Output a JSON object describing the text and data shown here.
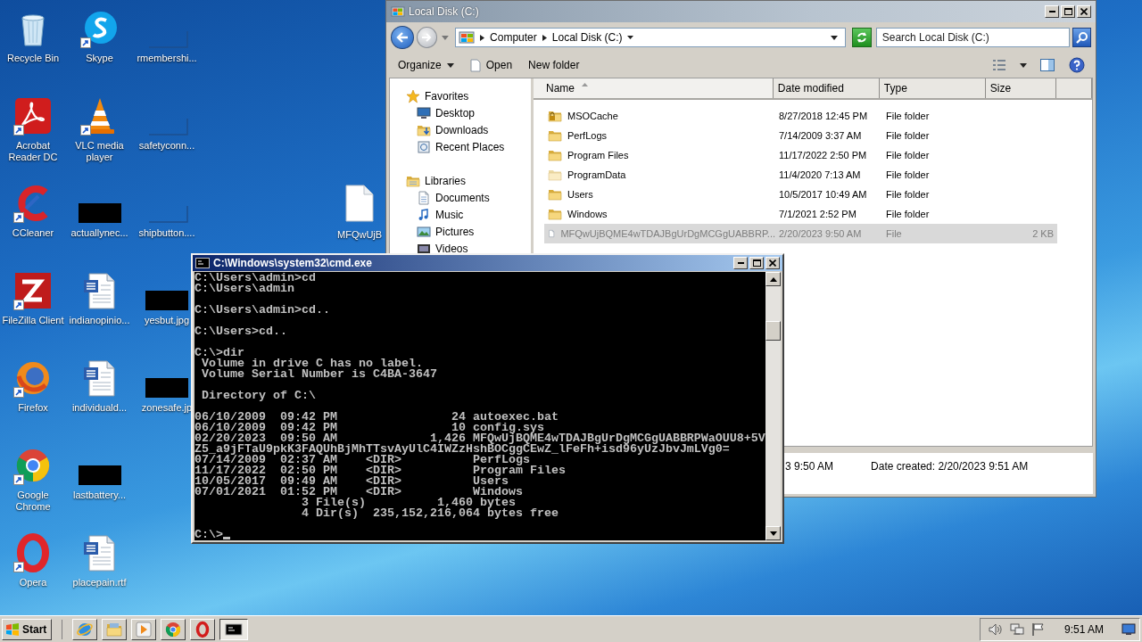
{
  "desktop": {
    "icons": [
      {
        "label": "Recycle Bin",
        "kind": "recycle-bin",
        "shortcut": false
      },
      {
        "label": "Acrobat Reader DC",
        "kind": "acrobat",
        "shortcut": true
      },
      {
        "label": "CCleaner",
        "kind": "ccleaner",
        "shortcut": true
      },
      {
        "label": "FileZilla Client",
        "kind": "filezilla",
        "shortcut": true
      },
      {
        "label": "Firefox",
        "kind": "firefox",
        "shortcut": true
      },
      {
        "label": "Google Chrome",
        "kind": "chrome",
        "shortcut": true
      },
      {
        "label": "Opera",
        "kind": "opera",
        "shortcut": true
      },
      {
        "label": "Skype",
        "kind": "skype",
        "shortcut": true
      },
      {
        "label": "VLC media player",
        "kind": "vlc",
        "shortcut": true
      },
      {
        "label": "actuallynec...",
        "kind": "thumbnail",
        "shortcut": false
      },
      {
        "label": "indianopinio...",
        "kind": "word",
        "shortcut": false
      },
      {
        "label": "individuald...",
        "kind": "word",
        "shortcut": false
      },
      {
        "label": "lastbattery...",
        "kind": "thumbnail",
        "shortcut": false
      },
      {
        "label": "placepain.rtf",
        "kind": "word",
        "shortcut": false
      },
      {
        "label": "rmembershi...",
        "kind": "blank",
        "shortcut": false
      },
      {
        "label": "safetyconn...",
        "kind": "blank",
        "shortcut": false
      },
      {
        "label": "shipbutton....",
        "kind": "blank",
        "shortcut": false
      },
      {
        "label": "yesbut.jpg",
        "kind": "thumbnail",
        "shortcut": false
      },
      {
        "label": "zonesafe.jp",
        "kind": "thumbnail",
        "shortcut": false
      }
    ],
    "loose_icon": {
      "label": "MFQwUjB",
      "kind": "file"
    }
  },
  "explorer": {
    "title": "Local Disk (C:)",
    "breadcrumbs": [
      "Computer",
      "Local Disk (C:)"
    ],
    "search_placeholder": "Search Local Disk (C:)",
    "commands": [
      {
        "label": "Organize",
        "kind": "menu"
      },
      {
        "label": "Open",
        "kind": "open"
      },
      {
        "label": "New folder",
        "kind": "plain"
      }
    ],
    "navigation": [
      {
        "label": "Favorites",
        "kind": "star",
        "children": [
          {
            "label": "Desktop",
            "kind": "desktop"
          },
          {
            "label": "Downloads",
            "kind": "downloads"
          },
          {
            "label": "Recent Places",
            "kind": "recent"
          }
        ]
      },
      {
        "label": "Libraries",
        "kind": "library",
        "children": [
          {
            "label": "Documents",
            "kind": "documents"
          },
          {
            "label": "Music",
            "kind": "music"
          },
          {
            "label": "Pictures",
            "kind": "pictures"
          },
          {
            "label": "Videos",
            "kind": "videos"
          }
        ]
      }
    ],
    "columns": [
      {
        "label": "Name",
        "sorted": true
      },
      {
        "label": "Date modified",
        "sorted": false
      },
      {
        "label": "Type",
        "sorted": false
      },
      {
        "label": "Size",
        "sorted": false
      }
    ],
    "rows": [
      {
        "name": "MSOCache",
        "date_modified": "8/27/2018 12:45 PM",
        "type": "File folder",
        "kind": "folder-locked",
        "selected": false
      },
      {
        "name": "PerfLogs",
        "date_modified": "7/14/2009 3:37 AM",
        "type": "File folder",
        "kind": "folder",
        "selected": false
      },
      {
        "name": "Program Files",
        "date_modified": "11/17/2022 2:50 PM",
        "type": "File folder",
        "kind": "folder",
        "selected": false
      },
      {
        "name": "ProgramData",
        "date_modified": "11/4/2020 7:13 AM",
        "type": "File folder",
        "kind": "folder-faded",
        "selected": false
      },
      {
        "name": "Users",
        "date_modified": "10/5/2017 10:49 AM",
        "type": "File folder",
        "kind": "folder",
        "selected": false
      },
      {
        "name": "Windows",
        "date_modified": "7/1/2021 2:52 PM",
        "type": "File folder",
        "kind": "folder",
        "selected": false
      },
      {
        "name": "MFQwUjBQME4wTDAJBgUrDgMCGgUABBRP...",
        "date_modified": "2/20/2023 9:50 AM",
        "type": "File",
        "size": "2 KB",
        "kind": "file",
        "selected": true
      }
    ],
    "details": [
      "3 9:50 AM",
      "Date created: 2/20/2023 9:51 AM"
    ]
  },
  "console": {
    "title": "C:\\Windows\\system32\\cmd.exe",
    "cursor": true,
    "blocks": [
      [
        "C:\\Users\\admin>cd",
        "C:\\Users\\admin"
      ],
      [
        "C:\\Users\\admin>cd.."
      ],
      [
        "C:\\Users>cd.."
      ],
      [
        "C:\\>dir",
        " Volume in drive C has no label.",
        " Volume Serial Number is C4BA-3647"
      ],
      [
        " Directory of C:\\"
      ],
      [
        "06/10/2009  09:42 PM                24 autoexec.bat",
        "06/10/2009  09:42 PM                10 config.sys",
        "02/20/2023  09:50 AM             1,426 MFQwUjBQME4wTDAJBgUrDgMCGgUABBRPWaOUU8+5V",
        "Z5_a9jFTaU9pkK3FAQUhBjMhTTsvAyUlC4IWZzHshBOCggCEwZ_lFeFh+isd96yUzJbvJmLVg0=",
        "07/14/2009  02:37 AM    <DIR>          PerfLogs",
        "11/17/2022  02:50 PM    <DIR>          Program Files",
        "10/05/2017  09:49 AM    <DIR>          Users",
        "07/01/2021  01:52 PM    <DIR>          Windows",
        "               3 File(s)          1,460 bytes",
        "               4 Dir(s)  235,152,216,064 bytes free"
      ],
      [
        "C:\\>"
      ]
    ]
  },
  "taskbar": {
    "start": "Start",
    "apps": [
      {
        "kind": "ie",
        "active": false
      },
      {
        "kind": "explorer",
        "active": false
      },
      {
        "kind": "media",
        "active": false
      },
      {
        "kind": "chrome",
        "active": false
      },
      {
        "kind": "opera",
        "active": false
      },
      {
        "kind": "console",
        "active": true
      }
    ],
    "clock": "9:51 AM"
  }
}
